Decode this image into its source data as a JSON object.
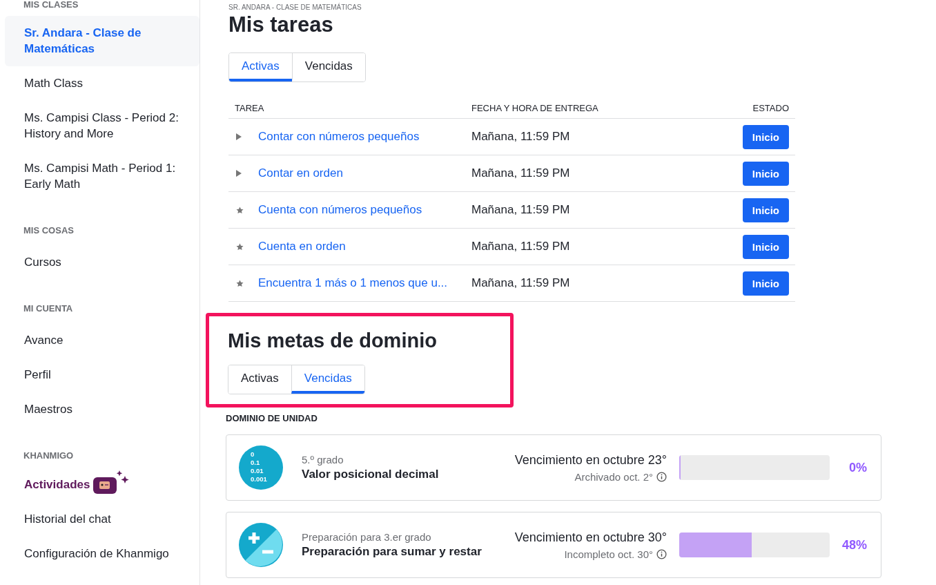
{
  "sidebar": {
    "sections": [
      {
        "heading": "MIS CLASES",
        "items": [
          {
            "label": "Sr. Andara - Clase de Matemáticas",
            "selected": true
          },
          {
            "label": "Math Class",
            "selected": false
          },
          {
            "label": "Ms. Campisi Class - Period 2: History and More",
            "selected": false
          },
          {
            "label": "Ms. Campisi Math - Period 1: Early Math",
            "selected": false
          }
        ]
      },
      {
        "heading": "MIS COSAS",
        "items": [
          {
            "label": "Cursos",
            "selected": false
          }
        ]
      },
      {
        "heading": "MI CUENTA",
        "items": [
          {
            "label": "Avance",
            "selected": false
          },
          {
            "label": "Perfil",
            "selected": false
          },
          {
            "label": "Maestros",
            "selected": false
          }
        ]
      },
      {
        "heading": "KHANMIGO",
        "items": [
          {
            "label": "Actividades",
            "selected": false,
            "kind": "khanmigo"
          },
          {
            "label": "Historial del chat",
            "selected": false
          },
          {
            "label": "Configuración de Khanmigo",
            "selected": false
          }
        ]
      }
    ]
  },
  "breadcrumb": "SR. ANDARA - CLASE DE MATEMÁTICAS",
  "assignments": {
    "title": "Mis tareas",
    "tabs": [
      {
        "label": "Activas",
        "selected": true
      },
      {
        "label": "Vencidas",
        "selected": false
      }
    ],
    "columns": [
      "TAREA",
      "FECHA Y HORA DE ENTREGA",
      "ESTADO"
    ],
    "rows": [
      {
        "kind": "video",
        "title": "Contar con números pequeños",
        "due": "Mañana, 11:59 PM",
        "action": "Inicio"
      },
      {
        "kind": "video",
        "title": "Contar en orden",
        "due": "Mañana, 11:59 PM",
        "action": "Inicio"
      },
      {
        "kind": "exercise",
        "title": "Cuenta con números pequeños",
        "due": "Mañana, 11:59 PM",
        "action": "Inicio"
      },
      {
        "kind": "exercise",
        "title": "Cuenta en orden",
        "due": "Mañana, 11:59 PM",
        "action": "Inicio"
      },
      {
        "kind": "exercise",
        "title": "Encuentra 1 más o 1 menos que u...",
        "due": "Mañana, 11:59 PM",
        "action": "Inicio"
      }
    ]
  },
  "mastery_goals": {
    "title": "Mis metas de dominio",
    "highlighted": true,
    "tabs": [
      {
        "label": "Activas",
        "selected": false
      },
      {
        "label": "Vencidas",
        "selected": true
      }
    ],
    "section_label": "DOMINIO DE UNIDAD",
    "goals": [
      {
        "kind": "decimal",
        "icon_lines": [
          "0",
          "0.1",
          "0.01",
          "0.001"
        ],
        "course": "5.º grado",
        "unit": "Valor posicional decimal",
        "due": "Vencimiento en octubre 23°",
        "status": "Archivado oct. 2°",
        "level": 0,
        "percent": "0%"
      },
      {
        "kind": "plusminus",
        "course": "Preparación para 3.er grado",
        "unit": "Preparación para sumar y restar",
        "due": "Vencimiento en octubre 30°",
        "status": "Incompleto oct. 30°",
        "level": 0.48,
        "percent": "48%"
      }
    ]
  }
}
